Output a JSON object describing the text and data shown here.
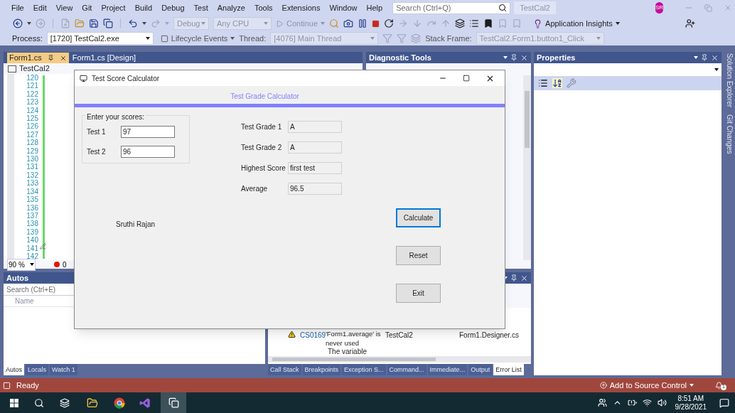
{
  "menu": [
    "File",
    "Edit",
    "View",
    "Git",
    "Project",
    "Build",
    "Debug",
    "Test",
    "Analyze",
    "Tools",
    "Extensions",
    "Window",
    "Help"
  ],
  "search": {
    "placeholder": "Search (Ctrl+Q)"
  },
  "solution_badge": "TestCal2",
  "avatar": "SR",
  "toolbar": {
    "configuration": "Debug",
    "platform": "Any CPU",
    "continue": "Continue",
    "application_insights": "Application Insights"
  },
  "debug_bar": {
    "process_label": "Process:",
    "process": "[1720] TestCal2.exe",
    "lifecycle": "Lifecycle Events",
    "thread_label": "Thread:",
    "thread": "[4076] Main Thread",
    "stack_frame_label": "Stack Frame:",
    "stack_frame": "TestCal2.Form1.button1_Click"
  },
  "document_tabs": [
    {
      "label": "Form1.cs",
      "selected": true
    },
    {
      "label": "Form1.cs [Design]",
      "selected": false
    }
  ],
  "editor": {
    "project": "TestCal2",
    "line_numbers": [
      "120",
      "121",
      "122",
      "123",
      "124",
      "125",
      "126",
      "127",
      "128",
      "129",
      "130",
      "131",
      "132",
      "133",
      "134",
      "135",
      "136",
      "137",
      "138",
      "139",
      "140",
      "141",
      "142"
    ],
    "zoom": "90 %",
    "error_count": "0"
  },
  "diagnostic_tools": {
    "title": "Diagnostic Tools"
  },
  "properties": {
    "title": "Properties"
  },
  "side_tabs": [
    "Solution Explorer",
    "Git Changes"
  ],
  "autos": {
    "title": "Autos",
    "search_placeholder": "Search (Ctrl+E)",
    "column": "Name",
    "tabs": [
      {
        "label": "Autos",
        "selected": true
      },
      {
        "label": "Locals",
        "selected": false
      },
      {
        "label": "Watch 1",
        "selected": false
      }
    ]
  },
  "error_list": {
    "rows": [
      {
        "code": "CS0169",
        "description": "'Form1.average' is never used",
        "project": "TestCal2",
        "file": "Form1.Designer.cs"
      }
    ],
    "next_row_text": "The variable",
    "tabs": [
      {
        "label": "Call Stack",
        "selected": false
      },
      {
        "label": "Breakpoints",
        "selected": false
      },
      {
        "label": "Exception S...",
        "selected": false
      },
      {
        "label": "Command...",
        "selected": false
      },
      {
        "label": "Immediate...",
        "selected": false
      },
      {
        "label": "Output",
        "selected": false
      },
      {
        "label": "Error List",
        "selected": true
      }
    ]
  },
  "status_bar": {
    "text": "Ready",
    "source_control": "Add to Source Control",
    "notifications": "1"
  },
  "taskbar": {
    "time": "8:51 AM",
    "date": "9/28/2021"
  },
  "dialog": {
    "title": "Test Score Calculator",
    "header": "Test Grade Calculator",
    "group_title": "Enter your scores:",
    "score_fields": [
      {
        "label": "Test 1",
        "value": "97"
      },
      {
        "label": "Test 2",
        "value": "96"
      }
    ],
    "result_fields": [
      {
        "label": "Test Grade 1",
        "value": "A"
      },
      {
        "label": "Test Grade 2",
        "value": "A"
      },
      {
        "label": "Highest Score",
        "value": "first test"
      },
      {
        "label": "Average",
        "value": "96.5"
      }
    ],
    "author": "Sruthi Rajan",
    "buttons": [
      {
        "label": "Calculate",
        "focused": true
      },
      {
        "label": "Reset",
        "focused": false
      },
      {
        "label": "Exit",
        "focused": false
      }
    ]
  }
}
